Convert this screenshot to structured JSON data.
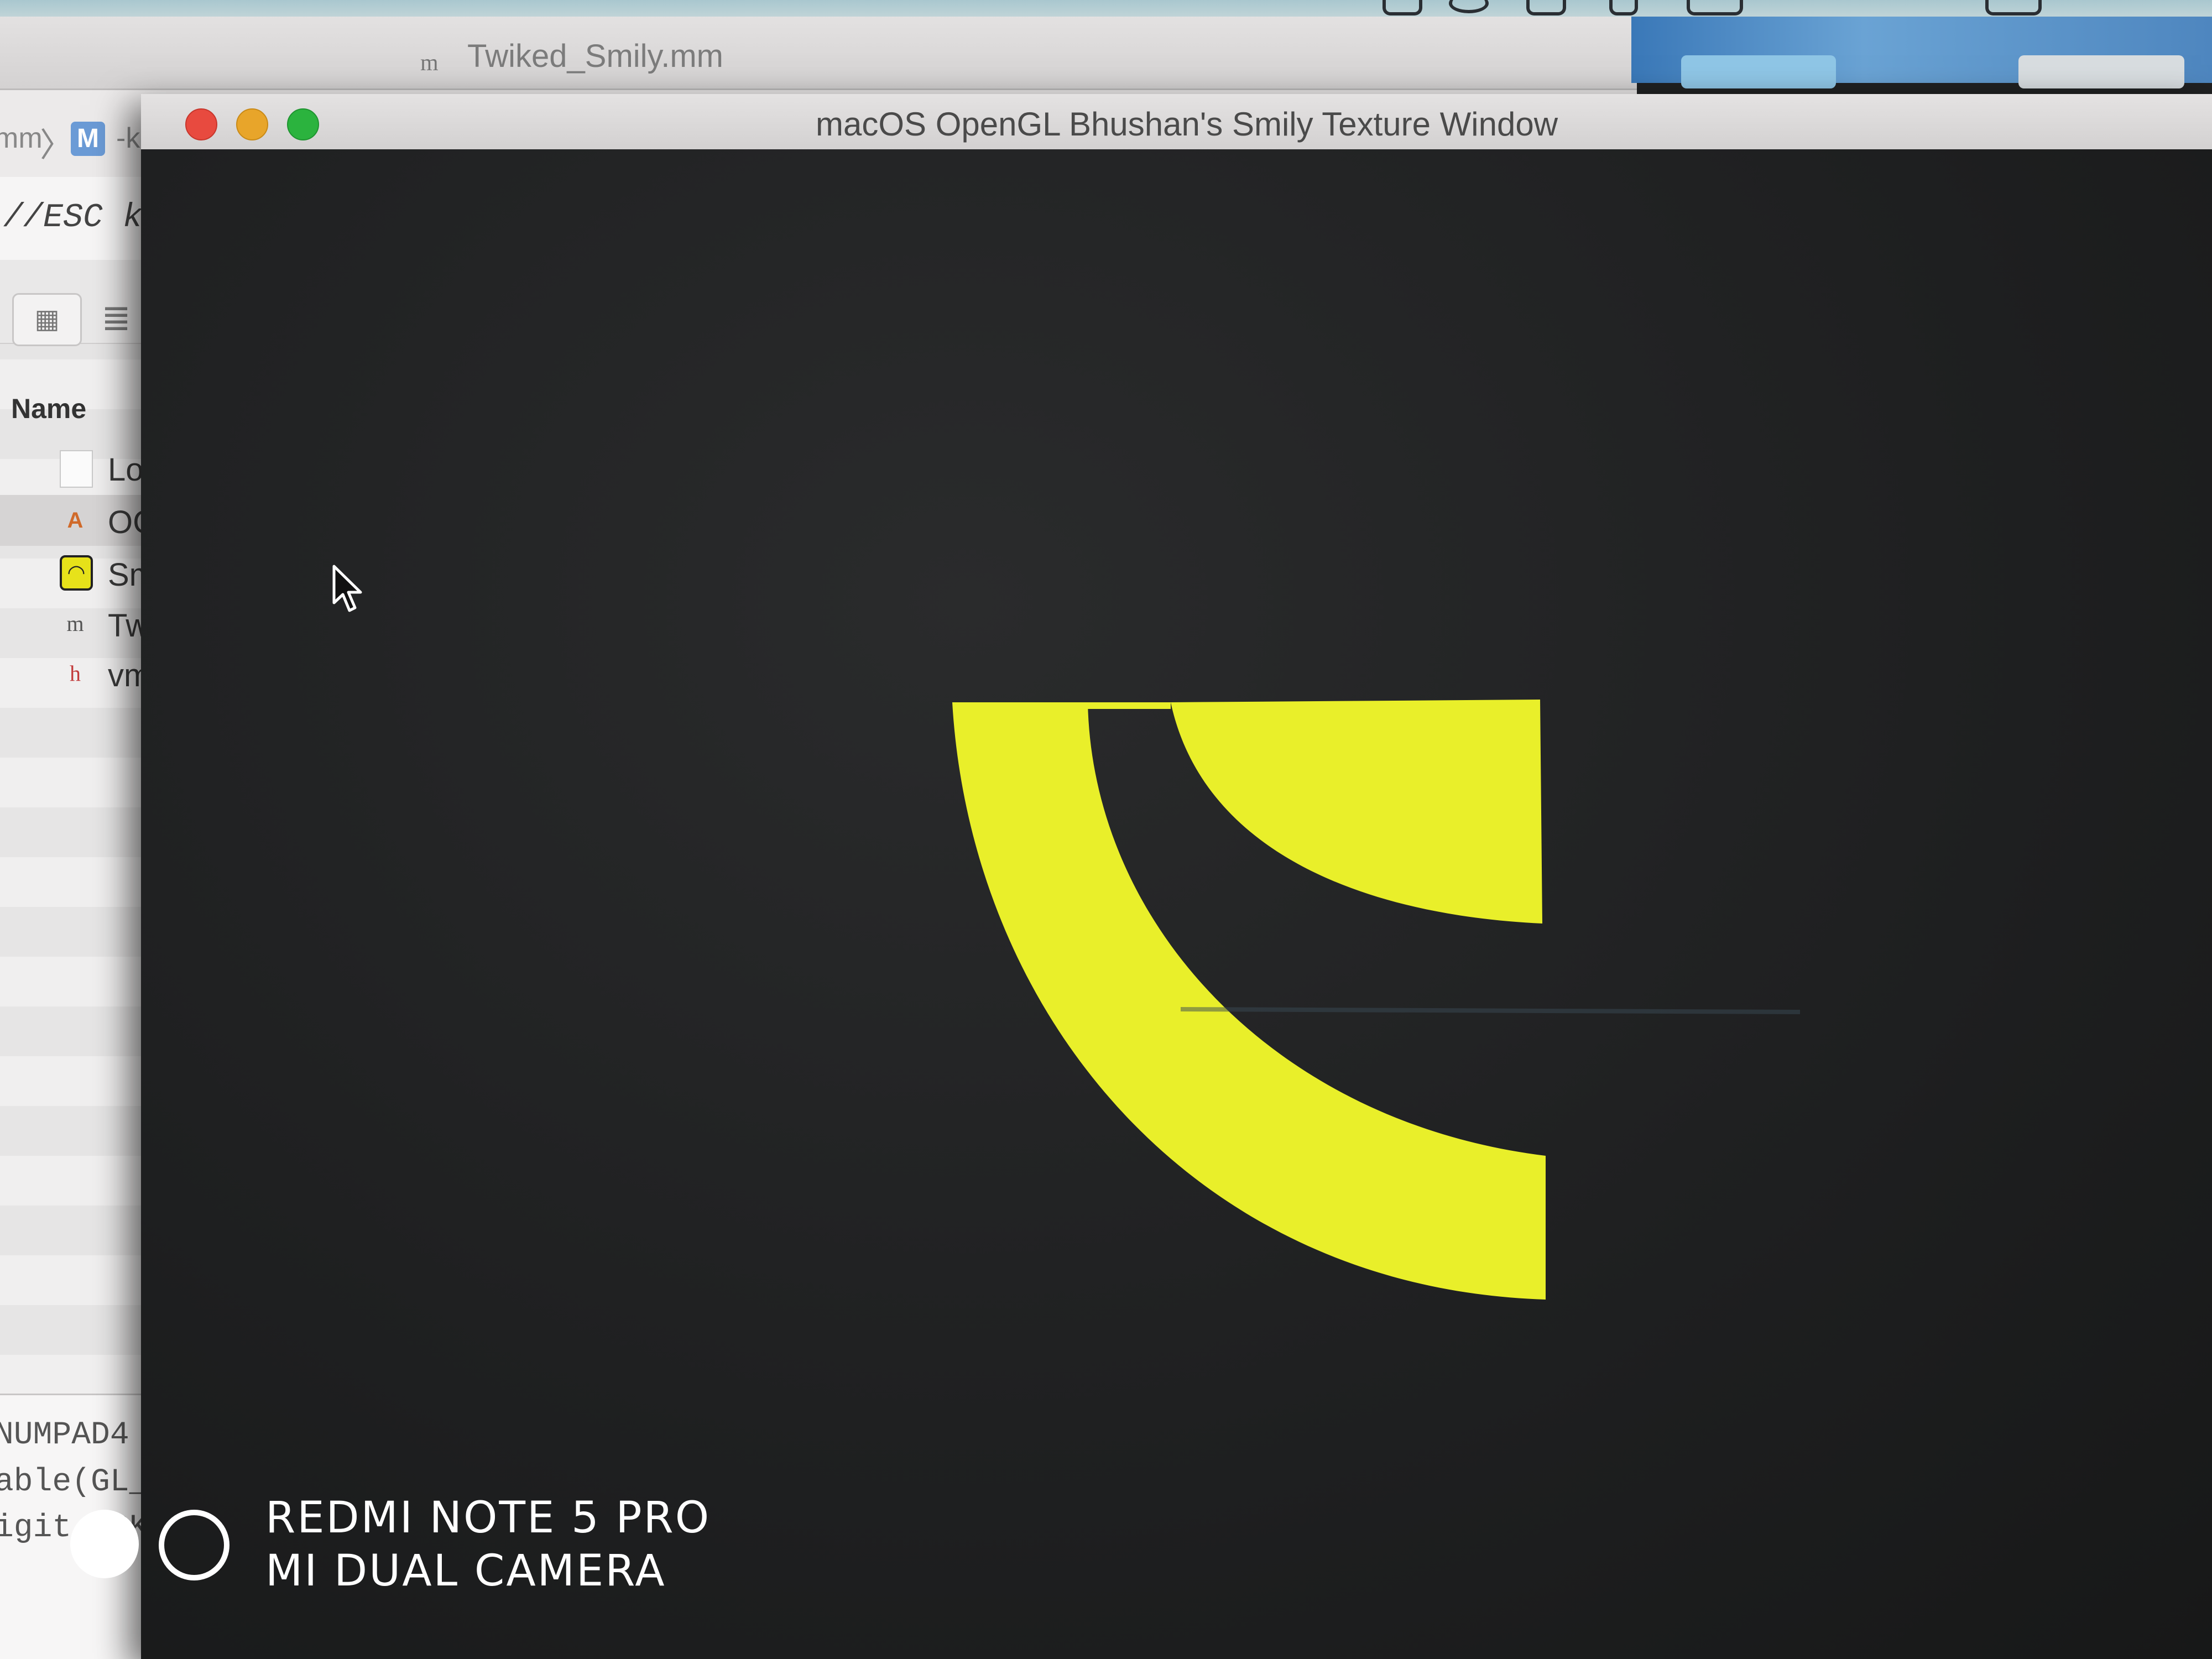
{
  "xcode": {
    "tab_file_icon": "m",
    "tab_title": "Twiked_Smily.mm",
    "jumpbar": {
      "prev_fragment": "mm",
      "chevron": "〉",
      "project_icon_letter": "M",
      "next_fragment": "-key"
    },
    "code_top_line": "//ESC key",
    "navigator": {
      "grid_icon": "▦",
      "list_icon": "≣",
      "column_header": "Name",
      "files": [
        {
          "icon": "document-icon",
          "icon_glyph": "",
          "label": "Log"
        },
        {
          "icon": "app-icon",
          "icon_glyph": "A",
          "label": "OG"
        },
        {
          "icon": "smily-icon",
          "icon_glyph": "◠",
          "label": "Sm"
        },
        {
          "icon": "objc-mm-file-icon",
          "icon_glyph": "m",
          "label": "Tw"
        },
        {
          "icon": "header-file-icon",
          "icon_glyph": "h",
          "label": "vm"
        }
      ]
    },
    "code_bottom_lines": [
      "NUMPAD4",
      "able(GL_",
      "igit_PPK"
    ]
  },
  "gl_window": {
    "title": "macOS OpenGL Bhushan's Smily Texture Window",
    "traffic_lights": {
      "close": "#e84a3f",
      "minimize": "#e8a52a",
      "zoom": "#2bb33e"
    },
    "texture_color": "#e9ef2a",
    "background_color": "#1e1f20"
  },
  "watermark": {
    "line1": "REDMI NOTE 5 PRO",
    "line2": "MI DUAL CAMERA"
  }
}
